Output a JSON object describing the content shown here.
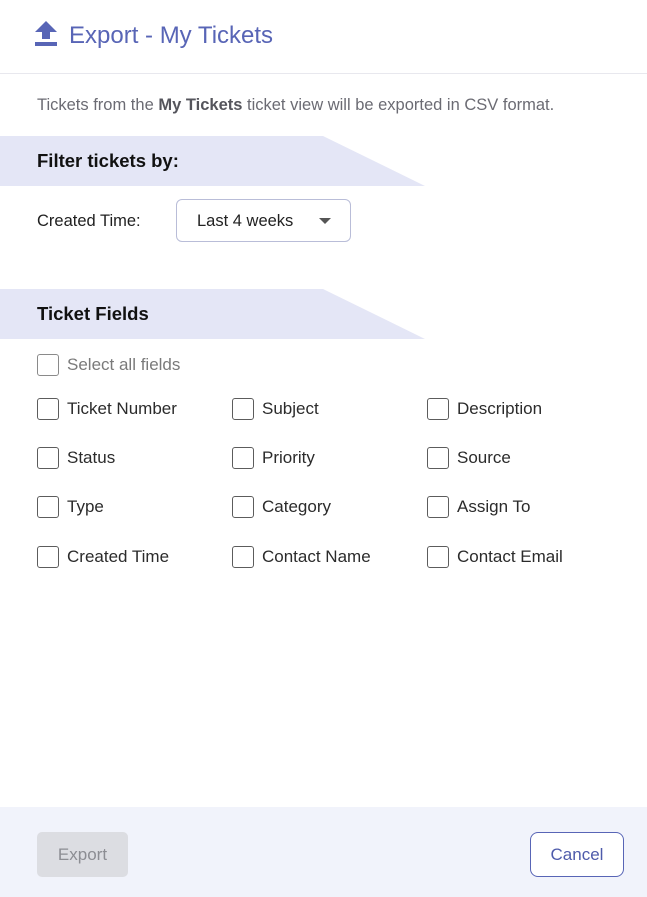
{
  "header": {
    "icon": "upload-icon",
    "title": "Export - My Tickets"
  },
  "intro": {
    "prefix": "Tickets from the ",
    "view_name": "My Tickets",
    "suffix": " ticket view will be exported in CSV format."
  },
  "filter_section": {
    "title": "Filter tickets by:",
    "created_time_label": "Created Time:",
    "created_time_value": "Last 4 weeks"
  },
  "fields_section": {
    "title": "Ticket Fields",
    "select_all_label": "Select all fields",
    "fields": [
      {
        "label": "Ticket Number",
        "checked": false
      },
      {
        "label": "Subject",
        "checked": false
      },
      {
        "label": "Description",
        "checked": false
      },
      {
        "label": "Status",
        "checked": false
      },
      {
        "label": "Priority",
        "checked": false
      },
      {
        "label": "Source",
        "checked": false
      },
      {
        "label": "Type",
        "checked": false
      },
      {
        "label": "Category",
        "checked": false
      },
      {
        "label": "Assign To",
        "checked": false
      },
      {
        "label": "Created Time",
        "checked": false
      },
      {
        "label": "Contact Name",
        "checked": false
      },
      {
        "label": "Contact Email",
        "checked": false
      }
    ]
  },
  "footer": {
    "export_label": "Export",
    "cancel_label": "Cancel"
  },
  "colors": {
    "accent": "#5865b6",
    "section_band": "#e4e6f6",
    "footer_bg": "#f1f3fb"
  }
}
